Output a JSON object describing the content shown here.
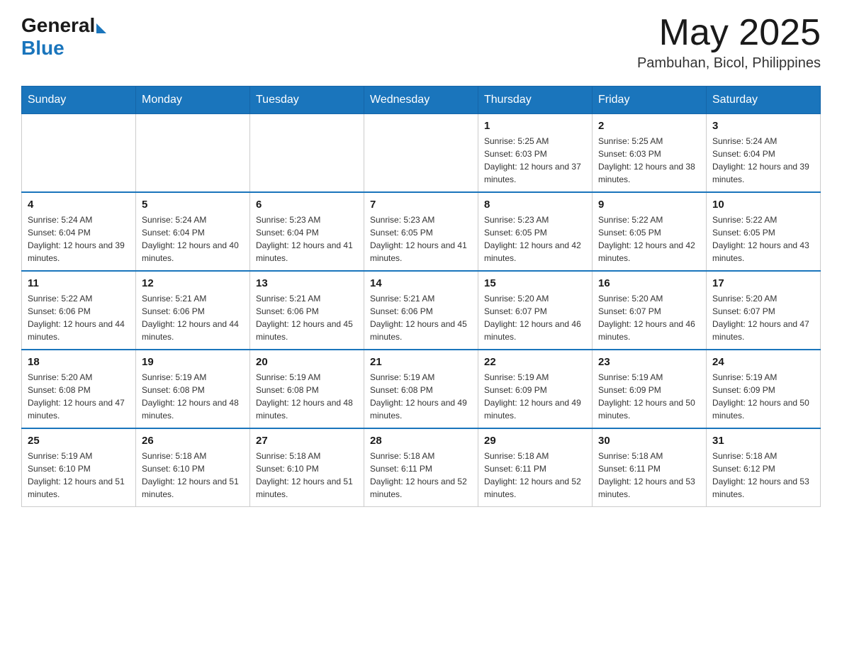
{
  "header": {
    "logo_general": "General",
    "logo_blue": "Blue",
    "month_year": "May 2025",
    "location": "Pambuhan, Bicol, Philippines"
  },
  "days_of_week": [
    "Sunday",
    "Monday",
    "Tuesday",
    "Wednesday",
    "Thursday",
    "Friday",
    "Saturday"
  ],
  "weeks": [
    [
      {
        "day": "",
        "info": ""
      },
      {
        "day": "",
        "info": ""
      },
      {
        "day": "",
        "info": ""
      },
      {
        "day": "",
        "info": ""
      },
      {
        "day": "1",
        "info": "Sunrise: 5:25 AM\nSunset: 6:03 PM\nDaylight: 12 hours and 37 minutes."
      },
      {
        "day": "2",
        "info": "Sunrise: 5:25 AM\nSunset: 6:03 PM\nDaylight: 12 hours and 38 minutes."
      },
      {
        "day": "3",
        "info": "Sunrise: 5:24 AM\nSunset: 6:04 PM\nDaylight: 12 hours and 39 minutes."
      }
    ],
    [
      {
        "day": "4",
        "info": "Sunrise: 5:24 AM\nSunset: 6:04 PM\nDaylight: 12 hours and 39 minutes."
      },
      {
        "day": "5",
        "info": "Sunrise: 5:24 AM\nSunset: 6:04 PM\nDaylight: 12 hours and 40 minutes."
      },
      {
        "day": "6",
        "info": "Sunrise: 5:23 AM\nSunset: 6:04 PM\nDaylight: 12 hours and 41 minutes."
      },
      {
        "day": "7",
        "info": "Sunrise: 5:23 AM\nSunset: 6:05 PM\nDaylight: 12 hours and 41 minutes."
      },
      {
        "day": "8",
        "info": "Sunrise: 5:23 AM\nSunset: 6:05 PM\nDaylight: 12 hours and 42 minutes."
      },
      {
        "day": "9",
        "info": "Sunrise: 5:22 AM\nSunset: 6:05 PM\nDaylight: 12 hours and 42 minutes."
      },
      {
        "day": "10",
        "info": "Sunrise: 5:22 AM\nSunset: 6:05 PM\nDaylight: 12 hours and 43 minutes."
      }
    ],
    [
      {
        "day": "11",
        "info": "Sunrise: 5:22 AM\nSunset: 6:06 PM\nDaylight: 12 hours and 44 minutes."
      },
      {
        "day": "12",
        "info": "Sunrise: 5:21 AM\nSunset: 6:06 PM\nDaylight: 12 hours and 44 minutes."
      },
      {
        "day": "13",
        "info": "Sunrise: 5:21 AM\nSunset: 6:06 PM\nDaylight: 12 hours and 45 minutes."
      },
      {
        "day": "14",
        "info": "Sunrise: 5:21 AM\nSunset: 6:06 PM\nDaylight: 12 hours and 45 minutes."
      },
      {
        "day": "15",
        "info": "Sunrise: 5:20 AM\nSunset: 6:07 PM\nDaylight: 12 hours and 46 minutes."
      },
      {
        "day": "16",
        "info": "Sunrise: 5:20 AM\nSunset: 6:07 PM\nDaylight: 12 hours and 46 minutes."
      },
      {
        "day": "17",
        "info": "Sunrise: 5:20 AM\nSunset: 6:07 PM\nDaylight: 12 hours and 47 minutes."
      }
    ],
    [
      {
        "day": "18",
        "info": "Sunrise: 5:20 AM\nSunset: 6:08 PM\nDaylight: 12 hours and 47 minutes."
      },
      {
        "day": "19",
        "info": "Sunrise: 5:19 AM\nSunset: 6:08 PM\nDaylight: 12 hours and 48 minutes."
      },
      {
        "day": "20",
        "info": "Sunrise: 5:19 AM\nSunset: 6:08 PM\nDaylight: 12 hours and 48 minutes."
      },
      {
        "day": "21",
        "info": "Sunrise: 5:19 AM\nSunset: 6:08 PM\nDaylight: 12 hours and 49 minutes."
      },
      {
        "day": "22",
        "info": "Sunrise: 5:19 AM\nSunset: 6:09 PM\nDaylight: 12 hours and 49 minutes."
      },
      {
        "day": "23",
        "info": "Sunrise: 5:19 AM\nSunset: 6:09 PM\nDaylight: 12 hours and 50 minutes."
      },
      {
        "day": "24",
        "info": "Sunrise: 5:19 AM\nSunset: 6:09 PM\nDaylight: 12 hours and 50 minutes."
      }
    ],
    [
      {
        "day": "25",
        "info": "Sunrise: 5:19 AM\nSunset: 6:10 PM\nDaylight: 12 hours and 51 minutes."
      },
      {
        "day": "26",
        "info": "Sunrise: 5:18 AM\nSunset: 6:10 PM\nDaylight: 12 hours and 51 minutes."
      },
      {
        "day": "27",
        "info": "Sunrise: 5:18 AM\nSunset: 6:10 PM\nDaylight: 12 hours and 51 minutes."
      },
      {
        "day": "28",
        "info": "Sunrise: 5:18 AM\nSunset: 6:11 PM\nDaylight: 12 hours and 52 minutes."
      },
      {
        "day": "29",
        "info": "Sunrise: 5:18 AM\nSunset: 6:11 PM\nDaylight: 12 hours and 52 minutes."
      },
      {
        "day": "30",
        "info": "Sunrise: 5:18 AM\nSunset: 6:11 PM\nDaylight: 12 hours and 53 minutes."
      },
      {
        "day": "31",
        "info": "Sunrise: 5:18 AM\nSunset: 6:12 PM\nDaylight: 12 hours and 53 minutes."
      }
    ]
  ]
}
